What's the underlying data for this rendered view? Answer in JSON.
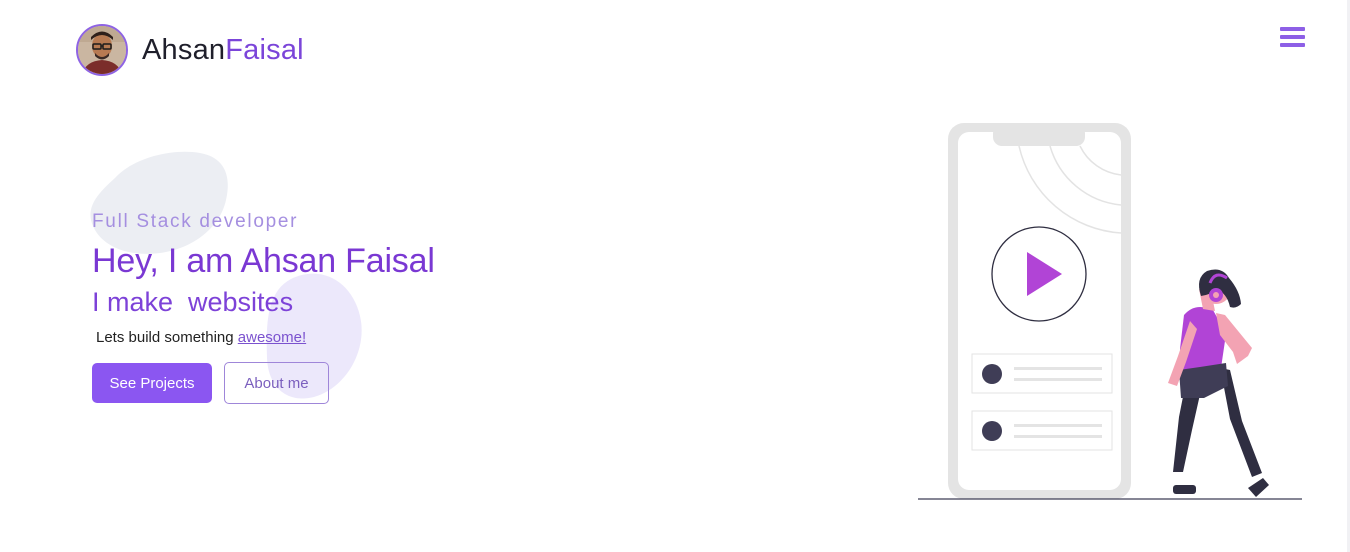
{
  "header": {
    "brand_first": "Ahsan",
    "brand_second": "Faisal",
    "avatar_alt": "Ahsan Faisal profile photo",
    "menu_icon": "hamburger-menu-icon"
  },
  "hero": {
    "kicker": "Full Stack developer",
    "title": "Hey, I am Ahsan Faisal",
    "subtitle": "I make  websites",
    "tagline_prefix": "Lets build something ",
    "tagline_link": "awesome!",
    "primary_button": "See Projects",
    "secondary_button": "About me"
  },
  "illustration": {
    "description_icons": [
      "phone-icon",
      "play-icon",
      "headphones-icon"
    ]
  },
  "colors": {
    "accent": "#7b45d9",
    "primary_button": "#8b56f1",
    "icon": "#8d5fe6",
    "play": "#b144d6"
  }
}
